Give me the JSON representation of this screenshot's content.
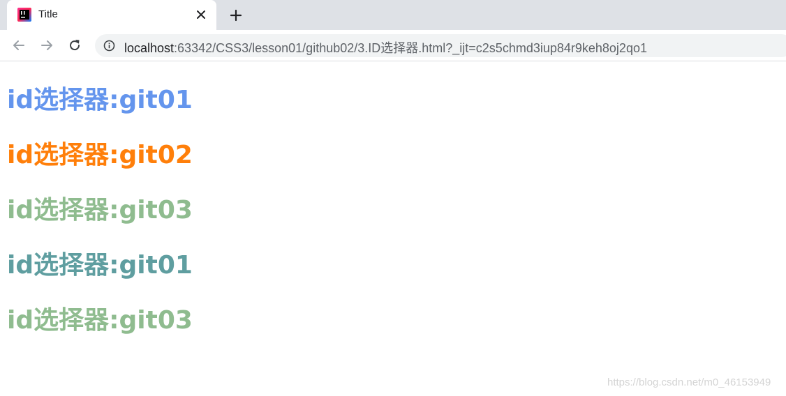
{
  "browser": {
    "tab": {
      "title": "Title",
      "favicon": "jetbrains-favicon-icon",
      "close_icon": "close-icon"
    },
    "new_tab_icon": "plus-icon",
    "toolbar": {
      "back_icon": "arrow-left-icon",
      "forward_icon": "arrow-right-icon",
      "reload_icon": "reload-icon",
      "info_icon": "info-icon",
      "url_host": "localhost",
      "url_rest": ":63342/CSS3/lesson01/github02/3.ID选择器.html?_ijt=c2s5chmd3iup84r9keh8oj2qo1"
    }
  },
  "page": {
    "headings": [
      {
        "text": "id选择器:git01",
        "color": "#6495ed"
      },
      {
        "text": "id选择器:git02",
        "color": "#ff7f0a"
      },
      {
        "text": "id选择器:git03",
        "color": "#8fbc8f"
      },
      {
        "text": "id选择器:git01",
        "color": "#5f9ea0"
      },
      {
        "text": "id选择器:git03",
        "color": "#8fbc8f"
      }
    ]
  },
  "watermark": "https://blog.csdn.net/m0_46153949"
}
